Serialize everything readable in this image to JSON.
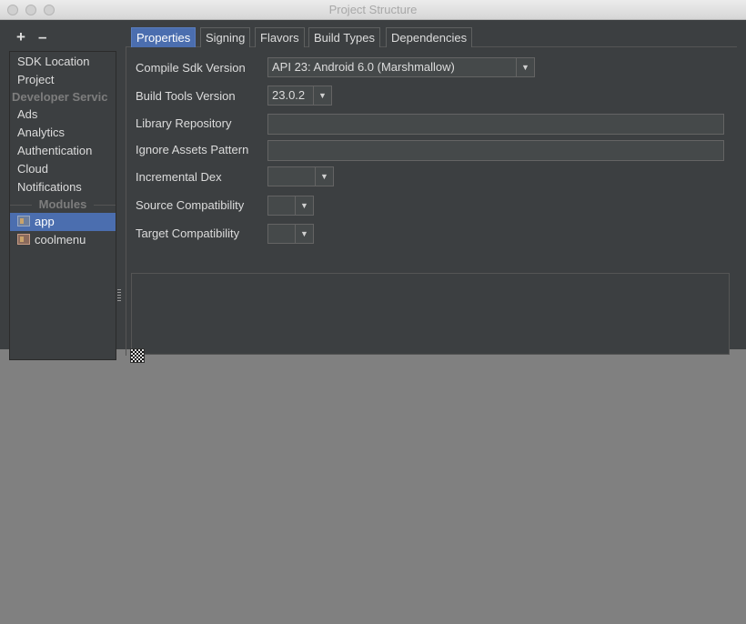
{
  "window": {
    "title": "Project Structure"
  },
  "sidebar": {
    "add_label": "+",
    "remove_label": "–",
    "items": [
      {
        "label": "SDK Location"
      },
      {
        "label": "Project"
      }
    ],
    "developer_services_header": "Developer Servic",
    "services": [
      {
        "label": "Ads"
      },
      {
        "label": "Analytics"
      },
      {
        "label": "Authentication"
      },
      {
        "label": "Cloud"
      },
      {
        "label": "Notifications"
      }
    ],
    "modules_header": "Modules",
    "modules": [
      {
        "label": "app",
        "selected": true,
        "icon": "module-folder-icon"
      },
      {
        "label": "coolmenu",
        "selected": false,
        "icon": "module-folder-icon"
      }
    ]
  },
  "tabs": [
    {
      "label": "Properties",
      "active": true
    },
    {
      "label": "Signing",
      "active": false
    },
    {
      "label": "Flavors",
      "active": false
    },
    {
      "label": "Build Types",
      "active": false
    },
    {
      "label": "Dependencies",
      "active": false
    }
  ],
  "properties": {
    "compile_sdk": {
      "label": "Compile Sdk Version",
      "value": "API 23: Android 6.0 (Marshmallow)"
    },
    "build_tools": {
      "label": "Build Tools Version",
      "value": "23.0.2"
    },
    "library_repository": {
      "label": "Library Repository",
      "value": ""
    },
    "ignore_assets": {
      "label": "Ignore Assets Pattern",
      "value": ""
    },
    "incremental_dex": {
      "label": "Incremental Dex",
      "value": ""
    },
    "source_compat": {
      "label": "Source Compatibility",
      "value": ""
    },
    "target_compat": {
      "label": "Target Compatibility",
      "value": ""
    }
  },
  "icons": {
    "dropdown": "▼"
  },
  "colors": {
    "background": "#3c3f41",
    "selection": "#4b6eaf",
    "text": "#dcdcdc"
  }
}
